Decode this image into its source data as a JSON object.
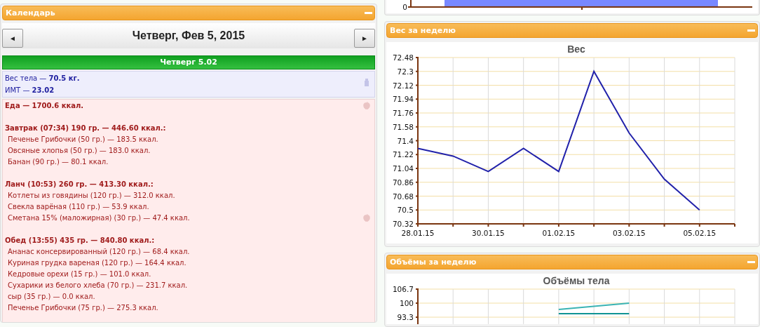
{
  "calendar_panel": {
    "title": "Календарь",
    "prev_button": "◄",
    "date_title": "Четверг, Фев 5, 2015",
    "next_button": "►",
    "day_bar": "Четверг 5.02",
    "body_stats": [
      "Вес тела — **70.5 кг.**",
      "ИМТ — **23.02**"
    ],
    "food_total": "Еда — 1700.6 ккал.",
    "meals": [
      {
        "header": "Завтрак (07:34) 190 гр. — 446.60 ккал.:",
        "items": [
          "Печенье Грибочки (50 гр.) — 183.5 ккал.",
          "Овсяные хлопья (50 гр.) — 183.0 ккал.",
          "Банан (90 гр.) — 80.1 ккал."
        ]
      },
      {
        "header": "Ланч (10:53) 260 гр. — 413.30 ккал.:",
        "items": [
          "Котлеты из говядины (120 гр.) — 312.0 ккал.",
          "Свекла варёная (110 гр.) — 53.9 ккал.",
          "Сметана 15% (маложирная) (30 гр.) — 47.4 ккал."
        ]
      },
      {
        "header": "Обед (13:55) 435 гр. — 840.80 ккал.:",
        "items": [
          "Ананас консервированный (120 гр.) — 68.4 ккал.",
          "Куриная грудка вареная (120 гр.) — 164.4 ккал.",
          "Кедровые орехи (15 гр.) — 101.0 ккал.",
          "Сухарики из белого хлеба (70 гр.) — 231.7 ккал.",
          "сыр (35 гр.) — 0.0 ккал.",
          "Печенье Грибочки (75 гр.) — 275.3 ккал."
        ]
      }
    ]
  },
  "top_chart_fragment": {
    "y_tick": "0"
  },
  "weight_panel": {
    "title": "Вес за неделю",
    "chart_data": {
      "type": "line",
      "title": "Вес",
      "grid": true,
      "ylim": [
        70.32,
        72.48
      ],
      "categories": [
        "28.01.15",
        null,
        "30.01.15",
        null,
        "01.02.15",
        null,
        "03.02.15",
        null,
        "05.02.15"
      ],
      "yticks": [
        70.32,
        70.5,
        70.68,
        70.86,
        71.04,
        71.22,
        71.4,
        71.58,
        71.76,
        71.94,
        72.12,
        72.3,
        72.48
      ],
      "series": [
        {
          "color": "#2222aa",
          "values": [
            71.3,
            71.2,
            71.0,
            71.3,
            71.0,
            72.3,
            71.5,
            70.9,
            70.5
          ]
        }
      ]
    }
  },
  "volume_panel": {
    "title": "Объёмы за неделю",
    "chart_data": {
      "type": "line",
      "title": "Объёмы тела",
      "grid": true,
      "ylim": [
        90,
        106.7
      ],
      "yticks": [
        93.3,
        100,
        106.7
      ],
      "series": [
        {
          "color": "#3ab4b4",
          "values": [
            null,
            null,
            null,
            null,
            97,
            null,
            100,
            null,
            null
          ]
        },
        {
          "color": "#109494",
          "values": [
            null,
            null,
            null,
            null,
            95,
            null,
            95,
            null,
            null
          ]
        }
      ]
    }
  }
}
